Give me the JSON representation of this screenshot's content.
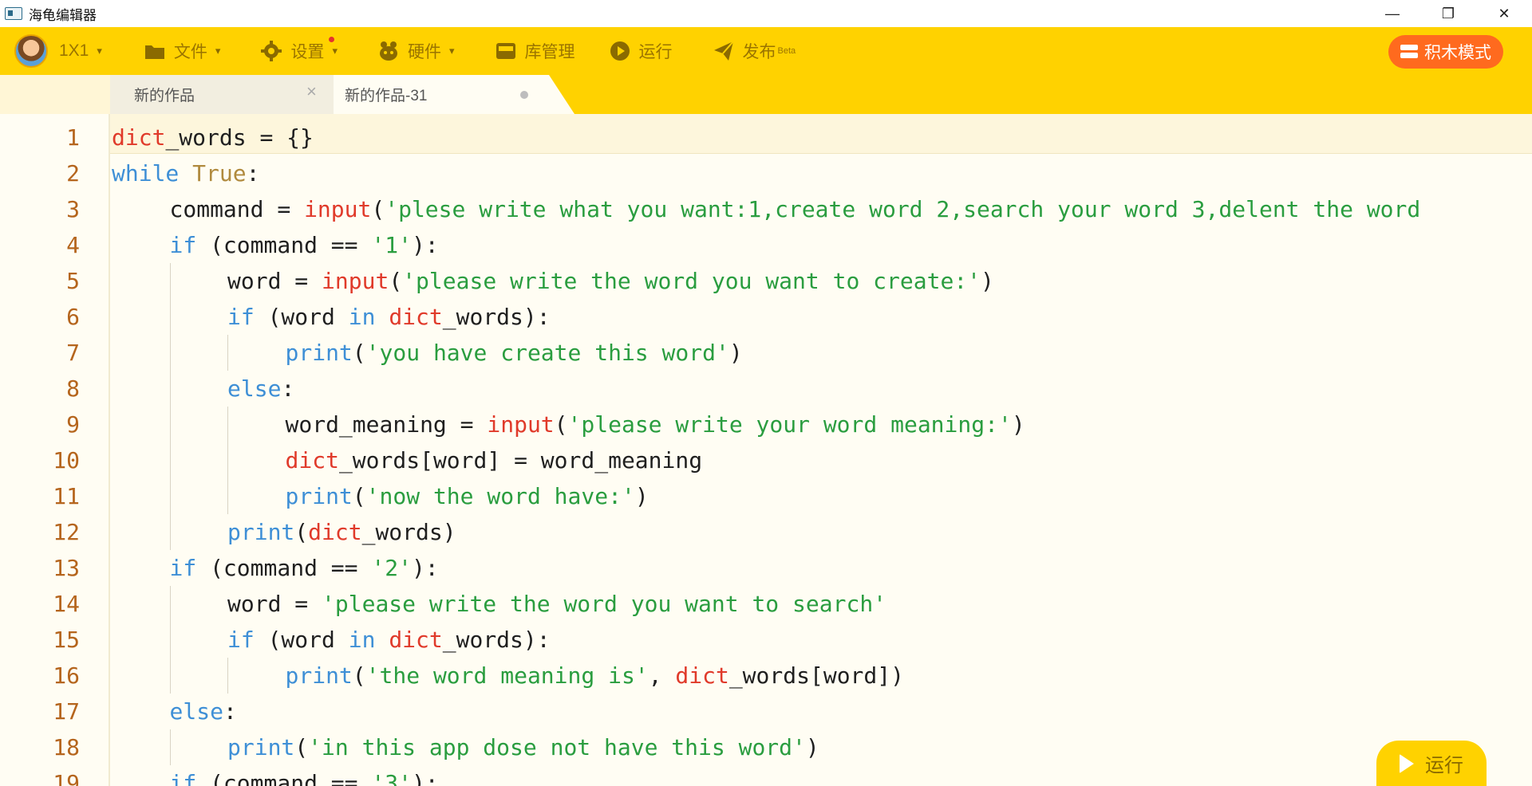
{
  "window": {
    "title": "海龟编辑器",
    "minimize_icon": "minimize-icon",
    "maximize_icon": "restore-icon",
    "close_icon": "close-icon",
    "minimize_glyph": "—",
    "restore_glyph": "❐",
    "close_glyph": "✕"
  },
  "toolbar": {
    "user_label": "1X1",
    "file_label": "文件",
    "settings_label": "设置",
    "hardware_label": "硬件",
    "library_label": "库管理",
    "run_label": "运行",
    "publish_label": "发布",
    "publish_badge": "Beta",
    "block_mode_label": "积木模式",
    "caret": "▾",
    "colors": {
      "bar": "#ffd200",
      "icon": "#8a6a00",
      "block_mode": "#ff6a1e",
      "badge": "#e5322d"
    }
  },
  "tabs": [
    {
      "label": "新的作品",
      "close": "×"
    },
    {
      "label": "新的作品-31",
      "unsaved": true
    }
  ],
  "editor": {
    "line_numbers": [
      "1",
      "2",
      "3",
      "4",
      "5",
      "6",
      "7",
      "8",
      "9",
      "10",
      "11",
      "12",
      "13",
      "14",
      "15",
      "16",
      "17",
      "18",
      "19"
    ],
    "lines": [
      {
        "indent": 0,
        "tokens": [
          [
            "bi",
            "dict"
          ],
          [
            "",
            "_words = {}"
          ]
        ]
      },
      {
        "indent": 0,
        "tokens": [
          [
            "kw",
            "while"
          ],
          [
            "",
            " "
          ],
          [
            "cst",
            "True"
          ],
          [
            "",
            ":"
          ]
        ]
      },
      {
        "indent": 1,
        "tokens": [
          [
            "",
            "command = "
          ],
          [
            "bi",
            "input"
          ],
          [
            "",
            "("
          ],
          [
            "str",
            "'plese write what you want:1,create word 2,search your word 3,delent the word"
          ]
        ]
      },
      {
        "indent": 1,
        "tokens": [
          [
            "kw",
            "if"
          ],
          [
            "",
            " (command == "
          ],
          [
            "str",
            "'1'"
          ],
          [
            "",
            "):"
          ]
        ]
      },
      {
        "indent": 2,
        "tokens": [
          [
            "",
            "word = "
          ],
          [
            "bi",
            "input"
          ],
          [
            "",
            "("
          ],
          [
            "str",
            "'please write the word you want to create:'"
          ],
          [
            "",
            ")"
          ]
        ]
      },
      {
        "indent": 2,
        "tokens": [
          [
            "kw",
            "if"
          ],
          [
            "",
            " (word "
          ],
          [
            "kw",
            "in"
          ],
          [
            "",
            " "
          ],
          [
            "bi",
            "dict"
          ],
          [
            "",
            "_words):"
          ]
        ]
      },
      {
        "indent": 3,
        "tokens": [
          [
            "kw",
            "print"
          ],
          [
            "",
            "("
          ],
          [
            "str",
            "'you have create this word'"
          ],
          [
            "",
            ")"
          ]
        ]
      },
      {
        "indent": 2,
        "tokens": [
          [
            "kw",
            "else"
          ],
          [
            "",
            ":"
          ]
        ]
      },
      {
        "indent": 3,
        "tokens": [
          [
            "",
            "word_meaning = "
          ],
          [
            "bi",
            "input"
          ],
          [
            "",
            "("
          ],
          [
            "str",
            "'please write your word meaning:'"
          ],
          [
            "",
            ")"
          ]
        ]
      },
      {
        "indent": 3,
        "tokens": [
          [
            "bi",
            "dict"
          ],
          [
            "",
            "_words[word] = word_meaning"
          ]
        ]
      },
      {
        "indent": 3,
        "tokens": [
          [
            "kw",
            "print"
          ],
          [
            "",
            "("
          ],
          [
            "str",
            "'now the word have:'"
          ],
          [
            "",
            ")"
          ]
        ]
      },
      {
        "indent": 2,
        "tokens": [
          [
            "kw",
            "print"
          ],
          [
            "",
            "("
          ],
          [
            "bi",
            "dict"
          ],
          [
            "",
            "_words)"
          ]
        ]
      },
      {
        "indent": 1,
        "tokens": [
          [
            "kw",
            "if"
          ],
          [
            "",
            " (command == "
          ],
          [
            "str",
            "'2'"
          ],
          [
            "",
            "):"
          ]
        ]
      },
      {
        "indent": 2,
        "tokens": [
          [
            "",
            "word = "
          ],
          [
            "str",
            "'please write the word you want to search'"
          ]
        ]
      },
      {
        "indent": 2,
        "tokens": [
          [
            "kw",
            "if"
          ],
          [
            "",
            " (word "
          ],
          [
            "kw",
            "in"
          ],
          [
            "",
            " "
          ],
          [
            "bi",
            "dict"
          ],
          [
            "",
            "_words):"
          ]
        ]
      },
      {
        "indent": 3,
        "tokens": [
          [
            "kw",
            "print"
          ],
          [
            "",
            "("
          ],
          [
            "str",
            "'the word meaning is'"
          ],
          [
            "",
            ", "
          ],
          [
            "bi",
            "dict"
          ],
          [
            "",
            "_words[word])"
          ]
        ]
      },
      {
        "indent": 1,
        "tokens": [
          [
            "kw",
            "else"
          ],
          [
            "",
            ":"
          ]
        ]
      },
      {
        "indent": 2,
        "tokens": [
          [
            "kw",
            "print"
          ],
          [
            "",
            "("
          ],
          [
            "str",
            "'in this app dose not have this word'"
          ],
          [
            "",
            ")"
          ]
        ]
      },
      {
        "indent": 1,
        "tokens": [
          [
            "kw",
            "if"
          ],
          [
            "",
            " (command == "
          ],
          [
            "str",
            "'3'"
          ],
          [
            "",
            "):"
          ]
        ]
      }
    ]
  },
  "run_button": {
    "label": "运行"
  }
}
